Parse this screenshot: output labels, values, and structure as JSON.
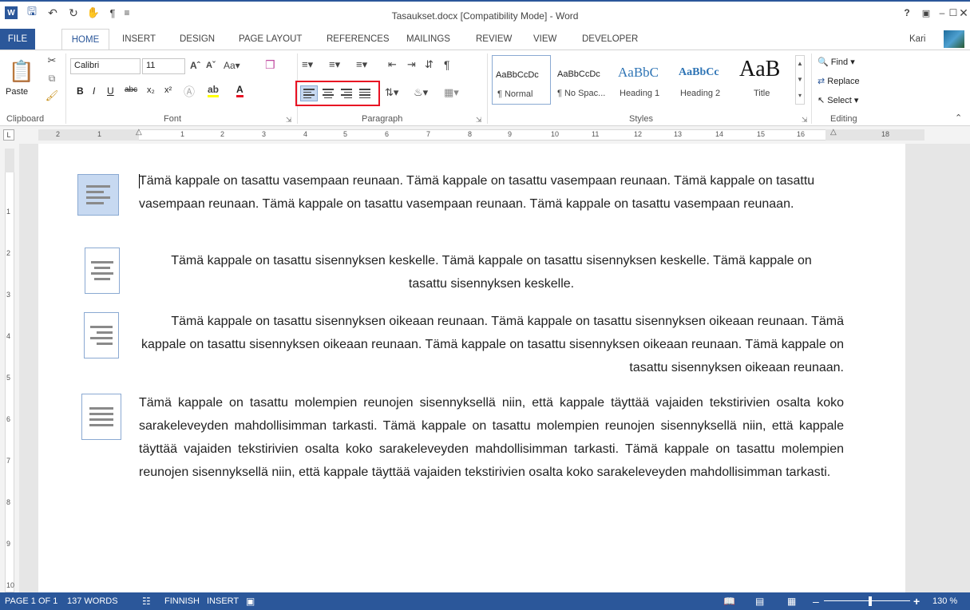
{
  "window": {
    "title": "Tasaukset.docx [Compatibility Mode] - Word",
    "user": "Kari"
  },
  "tabs": [
    "FILE",
    "HOME",
    "INSERT",
    "DESIGN",
    "PAGE LAYOUT",
    "REFERENCES",
    "MAILINGS",
    "REVIEW",
    "VIEW",
    "DEVELOPER"
  ],
  "ribbon": {
    "clipboard": {
      "paste_label": "Paste",
      "group_label": "Clipboard"
    },
    "font": {
      "font_name": "Calibri",
      "font_size": "11",
      "group_label": "Font"
    },
    "paragraph": {
      "group_label": "Paragraph"
    },
    "styles": {
      "group_label": "Styles",
      "items": [
        {
          "preview": "AaBbCcDc",
          "name": "¶ Normal"
        },
        {
          "preview": "AaBbCcDc",
          "name": "¶ No Spac..."
        },
        {
          "preview": "AaBbC",
          "name": "Heading 1"
        },
        {
          "preview": "AaBbCc",
          "name": "Heading 2"
        },
        {
          "preview": "AaB",
          "name": "Title"
        }
      ]
    },
    "editing": {
      "find": "Find",
      "replace": "Replace",
      "select": "Select",
      "group_label": "Editing"
    }
  },
  "ruler": {
    "h_marks": [
      "2",
      "1",
      "1",
      "2",
      "3",
      "4",
      "5",
      "6",
      "7",
      "8",
      "9",
      "10",
      "11",
      "12",
      "13",
      "14",
      "15",
      "16",
      "18"
    ],
    "v_marks": [
      "1",
      "2",
      "3",
      "4",
      "5",
      "6",
      "7",
      "8",
      "9",
      "10"
    ]
  },
  "document": {
    "p1": "Tämä kappale on tasattu vasempaan reunaan. Tämä kappale on tasattu vasempaan reunaan. Tämä kappale on tasattu vasempaan reunaan. Tämä kappale on tasattu vasempaan reunaan. Tämä kappale on tasattu vasempaan reunaan.",
    "p2": "Tämä kappale on tasattu sisennyksen keskelle. Tämä kappale on tasattu sisennyksen keskelle. Tämä kappale on tasattu sisennyksen keskelle.",
    "p3": "Tämä kappale on tasattu sisennyksen oikeaan reunaan. Tämä kappale on tasattu sisennyksen oikeaan reunaan. Tämä kappale on tasattu sisennyksen oikeaan reunaan. Tämä kappale on tasattu sisennyksen oikeaan reunaan. Tämä kappale on tasattu sisennyksen oikeaan reunaan.",
    "p4": "Tämä kappale on tasattu molempien reunojen sisennyksellä niin, että kappale täyttää vajaiden tekstirivien osalta koko sarakeleveyden mahdollisimman tarkasti. Tämä kappale on tasattu molempien reunojen sisennyksellä niin, että kappale täyttää vajaiden tekstirivien osalta koko sarakeleveyden mahdollisimman tarkasti. Tämä kappale on tasattu molempien reunojen sisennyksellä niin, että kappale täyttää vajaiden tekstirivien osalta koko sarakeleveyden mahdollisimman tarkasti."
  },
  "status": {
    "page": "PAGE 1 OF 1",
    "words": "137 WORDS",
    "language": "FINNISH",
    "mode": "INSERT",
    "zoom": "130 %",
    "zoom_level": 130
  },
  "colors": {
    "accent": "#2b579a",
    "highlight": "#e81123"
  }
}
